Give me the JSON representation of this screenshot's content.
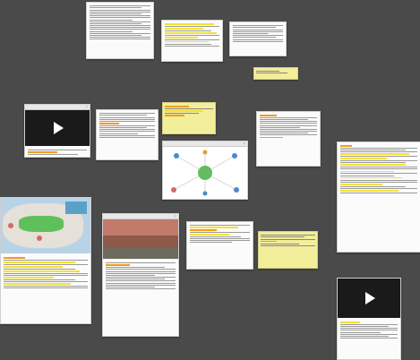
{
  "cards": {
    "c1": {
      "title": ""
    },
    "c2": {
      "title": ""
    },
    "c3": {
      "title": ""
    },
    "video_card": {
      "title": ""
    },
    "map_card": {
      "title": ""
    },
    "photo_card": {
      "title": ""
    },
    "diagram_card": {
      "title": ""
    },
    "right_card": {
      "title": ""
    },
    "right_video": {
      "title": ""
    }
  },
  "close_glyph": "×",
  "accent": {
    "highlight": "#f2e13a",
    "orange": "#f59a1e",
    "note": "#f2ee9a",
    "canvas": "#4a4a4a"
  }
}
